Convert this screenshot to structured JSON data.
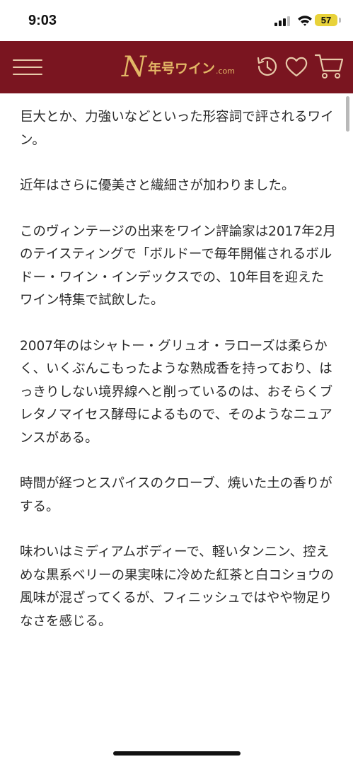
{
  "status_bar": {
    "time": "9:03",
    "battery": "57"
  },
  "header": {
    "logo_letter": "N",
    "logo_text": "年号ワイン",
    "logo_suffix": ".com",
    "icons": [
      "menu-icon",
      "history-icon",
      "heart-icon",
      "cart-icon"
    ],
    "background_color": "#7a1520",
    "accent_color": "#e3b766"
  },
  "article": {
    "paragraphs": [
      "巨大とか、力強いなどといった形容詞で評されるワイン。",
      "近年はさらに優美さと繊細さが加わりました。",
      "このヴィンテージの出来をワイン評論家は2017年2月のテイスティングで「ボルドーで毎年開催されるボルドー・ワイン・インデックスでの、10年目を迎えたワイン特集で試飲した。",
      "2007年のはシャトー・グリュオ・ラローズは柔らかく、いくぶんこもったような熟成香を持っており、はっきりしない境界線へと削っているのは、おそらくブレタノマイセス酵母によるもので、そのようなニュアンスがある。",
      "時間が経つとスパイスのクローブ、焼いた土の香りがする。",
      "味わいはミディアムボディーで、軽いタンニン、控えめな黒系ベリーの果実味に冷めた紅茶と白コショウの風味が混ざってくるが、フィニッシュではやや物足りなさを感じる。"
    ]
  }
}
